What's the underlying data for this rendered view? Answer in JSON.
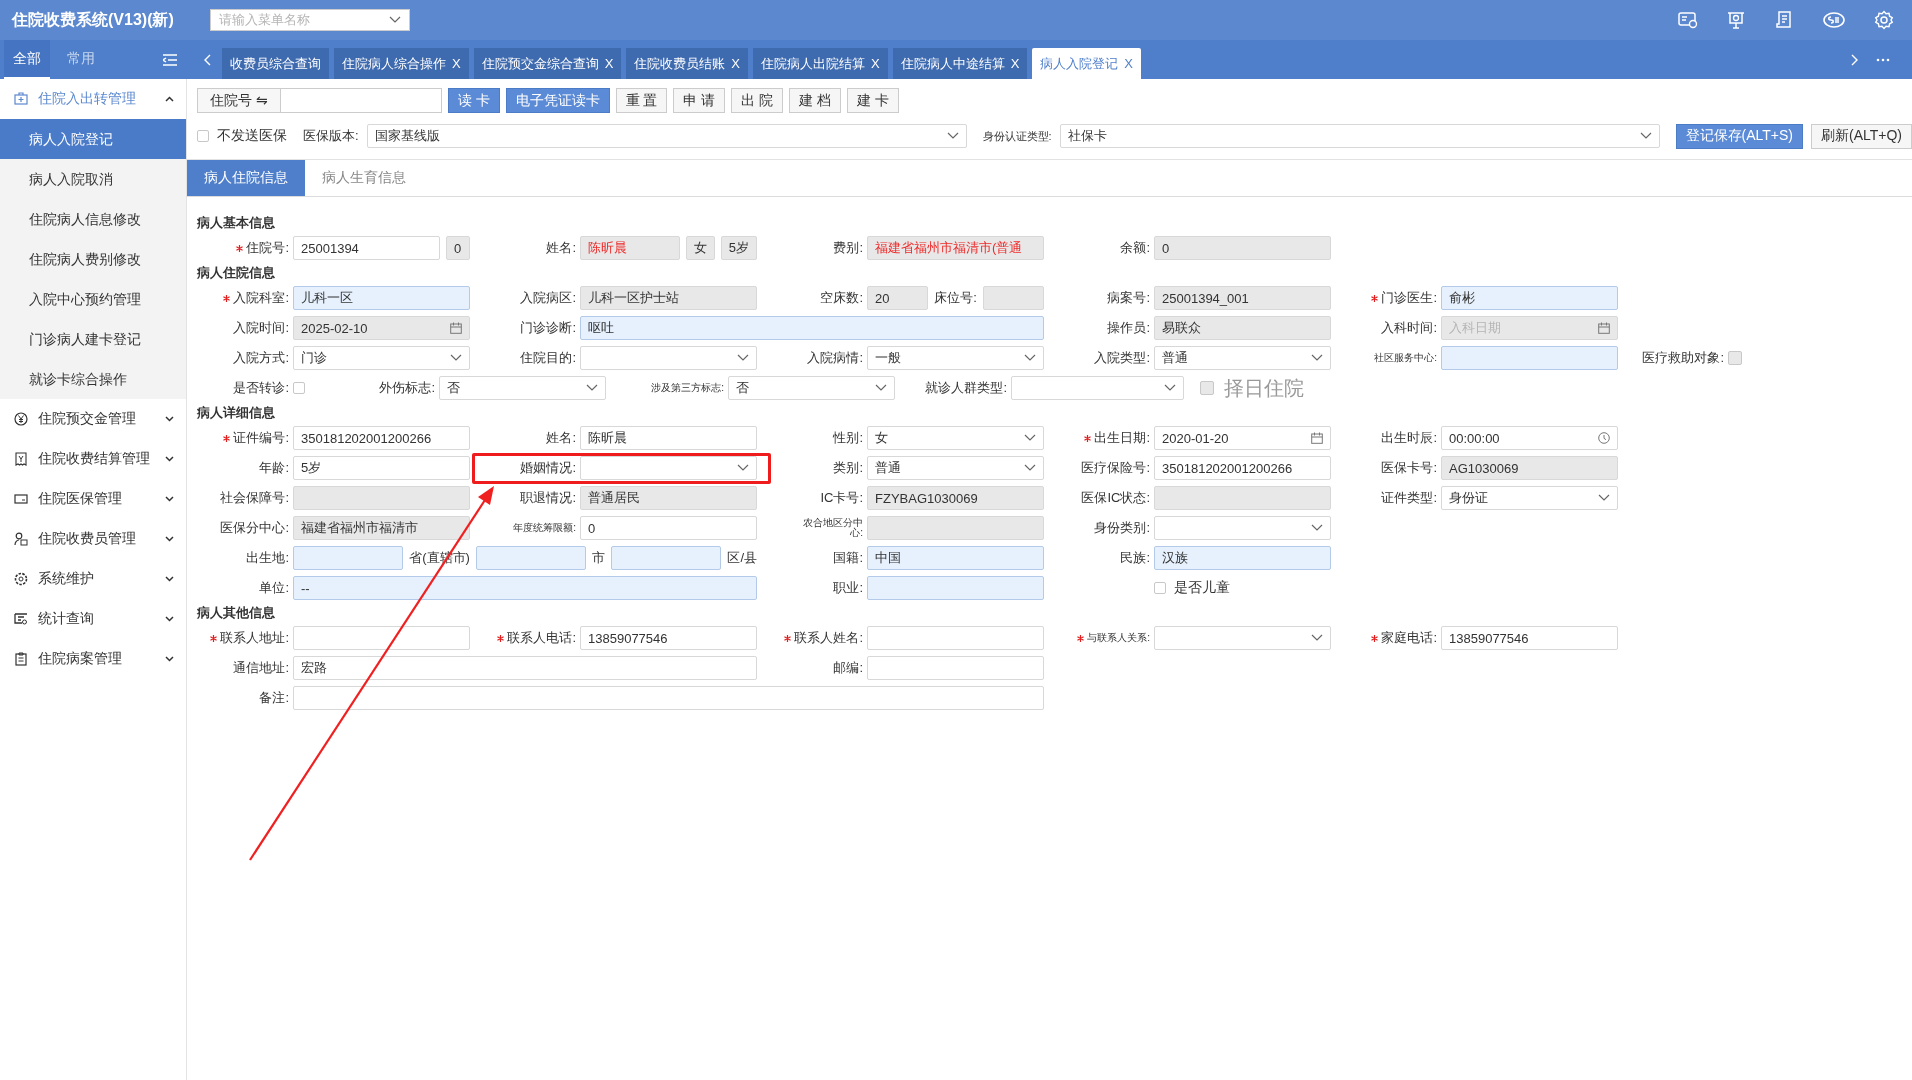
{
  "app": {
    "title": "住院收费系统(V13)(新)",
    "search": {
      "placeholder": "请输入菜单名称"
    }
  },
  "sidebar": {
    "tabs": [
      {
        "label": "全部",
        "selected": true
      },
      {
        "label": "常用",
        "selected": false
      }
    ],
    "menu": [
      {
        "label": "住院入出转管理",
        "expanded": true,
        "children": [
          {
            "label": "病人入院登记",
            "selected": true
          },
          {
            "label": "病人入院取消",
            "selected": false
          },
          {
            "label": "住院病人信息修改",
            "selected": false
          },
          {
            "label": "住院病人费别修改",
            "selected": false
          },
          {
            "label": "入院中心预约管理",
            "selected": false
          },
          {
            "label": "门诊病人建卡登记",
            "selected": false
          },
          {
            "label": "就诊卡综合操作",
            "selected": false
          }
        ]
      },
      {
        "label": "住院预交金管理",
        "expanded": false
      },
      {
        "label": "住院收费结算管理",
        "expanded": false
      },
      {
        "label": "住院医保管理",
        "expanded": false
      },
      {
        "label": "住院收费员管理",
        "expanded": false
      },
      {
        "label": "系统维护",
        "expanded": false
      },
      {
        "label": "统计查询",
        "expanded": false
      },
      {
        "label": "住院病案管理",
        "expanded": false
      }
    ]
  },
  "tabs": [
    {
      "label": "收费员综合查询",
      "selected": false
    },
    {
      "label": "住院病人综合操作",
      "close": "X",
      "selected": false
    },
    {
      "label": "住院预交金综合查询",
      "close": "X",
      "selected": false
    },
    {
      "label": "住院收费员结账",
      "close": "X",
      "selected": false
    },
    {
      "label": "住院病人出院结算",
      "close": "X",
      "selected": false
    },
    {
      "label": "住院病人中途结算",
      "close": "X",
      "selected": false
    },
    {
      "label": "病人入院登记",
      "close": "X",
      "selected": true
    }
  ],
  "toolbar": {
    "lookup": "住院号 ⇋",
    "buttons": [
      {
        "label": "读 卡",
        "kind": "primary"
      },
      {
        "label": "电子凭证读卡",
        "kind": "primary"
      },
      {
        "label": "重 置",
        "kind": "default"
      },
      {
        "label": "申 请",
        "kind": "default"
      },
      {
        "label": "出 院",
        "kind": "default"
      },
      {
        "label": "建 档",
        "kind": "default"
      },
      {
        "label": "建 卡",
        "kind": "default"
      }
    ],
    "option": {
      "label": "不发送医保",
      "checked": false
    },
    "selects": [
      {
        "label": "医保版本:",
        "value": "国家基线版"
      },
      {
        "label": "身份认证类型:",
        "value": "社保卡"
      }
    ],
    "actions": [
      {
        "label": "登记保存(ALT+S)",
        "kind": "primary"
      },
      {
        "label": "刷新(ALT+Q)",
        "kind": "default"
      }
    ]
  },
  "subtabs": [
    {
      "label": "病人住院信息",
      "selected": true
    },
    {
      "label": "病人生育信息",
      "selected": false
    }
  ],
  "form": {
    "sections": [
      {
        "title": "病人基本信息",
        "fields": [
          {
            "label": "住院号:",
            "required": true,
            "kind": "text",
            "readonly": false,
            "tinted": false,
            "alert": false,
            "value": "25001394",
            "extras": [
              {
                "value": "0",
                "readonly": true,
                "tinted": false
              }
            ]
          },
          {
            "label": "姓名:",
            "kind": "text",
            "readonly": true,
            "tinted": false,
            "alert": true,
            "value": "陈昕晨",
            "extras": [
              {
                "value": "女",
                "readonly": true,
                "tinted": false
              },
              {
                "value": "5岁",
                "readonly": true,
                "tinted": false
              }
            ]
          },
          {
            "label": "费别:",
            "required": false,
            "kind": "text",
            "readonly": true,
            "tinted": false,
            "alert": true,
            "value": "福建省福州市福清市(普通"
          },
          {
            "label": "余额:",
            "required": false,
            "kind": "text",
            "readonly": true,
            "tinted": false,
            "alert": false,
            "value": "0"
          }
        ]
      },
      {
        "title": "病人住院信息",
        "fields": [
          {
            "label": "入院科室:",
            "required": true,
            "kind": "text",
            "readonly": false,
            "tinted": true,
            "alert": false,
            "value": "儿科一区"
          },
          {
            "label": "入院病区:",
            "required": false,
            "kind": "text",
            "readonly": true,
            "tinted": false,
            "alert": false,
            "value": "儿科一区护士站"
          },
          {
            "label": "空床数:",
            "required": false,
            "kind": "text",
            "readonly": true,
            "tinted": false,
            "alert": false,
            "value": "20",
            "extras": [
              {
                "label": "床位号:",
                "readonly": true,
                "tinted": false
              }
            ]
          },
          {
            "label": "病案号:",
            "required": false,
            "kind": "text",
            "readonly": true,
            "tinted": false,
            "alert": false,
            "value": "25001394_001"
          },
          {
            "label": "门诊医生:",
            "required": true,
            "kind": "text",
            "readonly": false,
            "tinted": true,
            "alert": false,
            "value": "俞彬"
          },
          {
            "label": "入院时间:",
            "required": false,
            "kind": "date",
            "readonly": true,
            "tinted": false,
            "alert": false,
            "value": "2025-02-10"
          },
          {
            "label": "门诊诊断:",
            "required": false,
            "kind": "text",
            "readonly": false,
            "tinted": true,
            "alert": false,
            "value": "呕吐"
          },
          {
            "label": "操作员:",
            "required": false,
            "kind": "text",
            "readonly": true,
            "tinted": false,
            "alert": false,
            "value": "易联众"
          },
          {
            "label": "入科时间:",
            "required": false,
            "kind": "date",
            "readonly": true,
            "tinted": false,
            "placeholder": "入科日期"
          },
          {
            "label": "入院方式:",
            "required": false,
            "kind": "select",
            "readonly": false,
            "tinted": false,
            "alert": false,
            "value": "门诊"
          },
          {
            "label": "住院目的:",
            "required": false,
            "kind": "select",
            "readonly": false,
            "tinted": false
          },
          {
            "label": "入院病情:",
            "required": false,
            "kind": "select",
            "readonly": false,
            "tinted": false,
            "alert": false,
            "value": "一般"
          },
          {
            "label": "入院类型:",
            "required": false,
            "kind": "select",
            "readonly": false,
            "tinted": false,
            "alert": false,
            "value": "普通"
          },
          {
            "label": "社区服务中心:",
            "required": false,
            "kind": "text",
            "readonly": false,
            "tinted": true
          },
          {
            "label": "医疗救助对象:",
            "kind": "checkbox",
            "checked": false,
            "disabled": true
          },
          {
            "label": "是否转诊:",
            "kind": "checkbox",
            "checked": false,
            "disabled": false
          },
          {
            "label": "外伤标志:",
            "required": false,
            "kind": "select",
            "readonly": false,
            "tinted": false,
            "alert": false,
            "value": "否"
          },
          {
            "label": "涉及第三方标志:",
            "required": false,
            "kind": "select",
            "readonly": false,
            "tinted": false,
            "alert": false,
            "value": "否"
          },
          {
            "label": "就诊人群类型:",
            "required": false,
            "kind": "select",
            "readonly": false,
            "tinted": false
          },
          {
            "label": "择日住院",
            "kind": "check-after",
            "checked": false,
            "disabled": true
          }
        ]
      },
      {
        "title": "病人详细信息",
        "fields": [
          {
            "label": "证件编号:",
            "required": true,
            "kind": "text",
            "readonly": false,
            "tinted": false,
            "alert": false,
            "value": "350181202001200266"
          },
          {
            "label": "姓名:",
            "required": false,
            "kind": "text",
            "readonly": false,
            "tinted": false,
            "alert": false,
            "value": "陈昕晨"
          },
          {
            "label": "性别:",
            "required": false,
            "kind": "select",
            "readonly": false,
            "tinted": false,
            "alert": false,
            "value": "女"
          },
          {
            "label": "出生日期:",
            "required": true,
            "kind": "date",
            "readonly": false,
            "tinted": false,
            "alert": false,
            "value": "2020-01-20"
          },
          {
            "label": "出生时辰:",
            "required": false,
            "kind": "time",
            "readonly": false,
            "tinted": false,
            "alert": false,
            "value": "00:00:00"
          },
          {
            "label": "年龄:",
            "required": false,
            "kind": "text",
            "readonly": false,
            "tinted": false,
            "alert": false,
            "value": "5岁"
          },
          {
            "label": "婚姻情况:",
            "required": false,
            "kind": "select",
            "readonly": false,
            "tinted": false,
            "highlighted": true
          },
          {
            "label": "类别:",
            "required": false,
            "kind": "select",
            "readonly": false,
            "tinted": false,
            "alert": false,
            "value": "普通"
          },
          {
            "label": "医疗保险号:",
            "required": false,
            "kind": "text",
            "readonly": false,
            "tinted": false,
            "alert": false,
            "value": "350181202001200266"
          },
          {
            "label": "医保卡号:",
            "required": false,
            "kind": "text",
            "readonly": true,
            "tinted": false,
            "alert": false,
            "value": "AG1030069"
          },
          {
            "label": "社会保障号:",
            "required": false,
            "kind": "text",
            "readonly": true,
            "tinted": false
          },
          {
            "label": "职退情况:",
            "required": false,
            "kind": "text",
            "readonly": true,
            "tinted": false,
            "alert": false,
            "value": "普通居民"
          },
          {
            "label": "IC卡号:",
            "required": false,
            "kind": "text",
            "readonly": true,
            "tinted": false,
            "alert": false,
            "value": "FZYBAG1030069"
          },
          {
            "label": "医保IC状态:",
            "required": false,
            "kind": "text",
            "readonly": true,
            "tinted": false
          },
          {
            "label": "证件类型:",
            "required": false,
            "kind": "select",
            "readonly": false,
            "tinted": false,
            "alert": false,
            "value": "身份证"
          },
          {
            "label": "医保分中心:",
            "required": false,
            "kind": "text",
            "readonly": true,
            "tinted": false,
            "alert": false,
            "value": "福建省福州市福清市"
          },
          {
            "label": "年度统筹限额:",
            "required": false,
            "kind": "text",
            "readonly": false,
            "tinted": false,
            "alert": false,
            "value": "0"
          },
          {
            "label": "农合地区分中心:",
            "required": false,
            "kind": "text",
            "readonly": true,
            "tinted": false
          },
          {
            "label": "身份类别:",
            "required": false,
            "kind": "select",
            "readonly": false,
            "tinted": false
          },
          {
            "label": "出生地:",
            "required": false,
            "kind": "text",
            "readonly": false,
            "tinted": true,
            "extras": [
              {
                "label": "省(直辖市)",
                "readonly": false,
                "tinted": true
              },
              {
                "label": "市",
                "readonly": false,
                "tinted": true
              }
            ],
            "suffix": "区/县"
          },
          {
            "label": "国籍:",
            "required": false,
            "kind": "text",
            "readonly": false,
            "tinted": true,
            "alert": false,
            "value": "中国"
          },
          {
            "label": "民族:",
            "required": false,
            "kind": "text",
            "readonly": false,
            "tinted": true,
            "alert": false,
            "value": "汉族"
          },
          {
            "label": "单位:",
            "required": false,
            "kind": "text",
            "readonly": false,
            "tinted": true,
            "alert": false,
            "value": "--"
          },
          {
            "label": "职业:",
            "required": false,
            "kind": "text",
            "readonly": false,
            "tinted": true
          },
          {
            "label": "是否儿童",
            "kind": "check-after",
            "checked": false,
            "disabled": false
          }
        ]
      },
      {
        "title": "病人其他信息",
        "fields": [
          {
            "label": "联系人地址:",
            "required": true,
            "kind": "text",
            "readonly": false,
            "tinted": false
          },
          {
            "label": "联系人电话:",
            "required": true,
            "kind": "text",
            "readonly": false,
            "tinted": false,
            "alert": false,
            "value": "13859077546"
          },
          {
            "label": "联系人姓名:",
            "required": true,
            "kind": "text",
            "readonly": false,
            "tinted": false
          },
          {
            "label": "与联系人关系:",
            "required": true,
            "kind": "select",
            "readonly": false,
            "tinted": false
          },
          {
            "label": "家庭电话:",
            "required": true,
            "kind": "text",
            "readonly": false,
            "tinted": false,
            "alert": false,
            "value": "13859077546"
          },
          {
            "label": "通信地址:",
            "required": false,
            "kind": "text",
            "readonly": false,
            "tinted": false,
            "alert": false,
            "value": "宏路"
          },
          {
            "label": "邮编:",
            "required": false,
            "kind": "text",
            "readonly": false,
            "tinted": false
          },
          {
            "label": "备注:",
            "required": false,
            "kind": "text",
            "readonly": false,
            "tinted": false
          }
        ]
      }
    ]
  }
}
